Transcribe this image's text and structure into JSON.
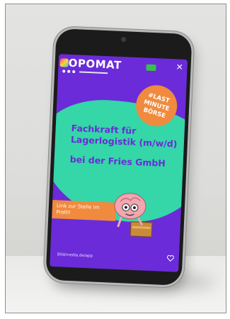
{
  "logo": {
    "text": "OPOMAT"
  },
  "badge": {
    "lines": [
      "#LAST",
      "MINUTE",
      "BÖRSE"
    ]
  },
  "headline": {
    "line1": "Fachkraft für Lagerlogistik (m/w/d)",
    "line2": "bei der Fries GmbH"
  },
  "cta": {
    "label": "Link zur Stelle im Profil!"
  },
  "footer": {
    "text": "Bild/media.de/app"
  },
  "icons": [
    "close-icon",
    "flag-icon",
    "heart-icon",
    "brain-mascot-icon"
  ],
  "colors": {
    "background": "#6b2bd9",
    "accent": "#35d6a8",
    "highlight": "#f08a3e"
  }
}
